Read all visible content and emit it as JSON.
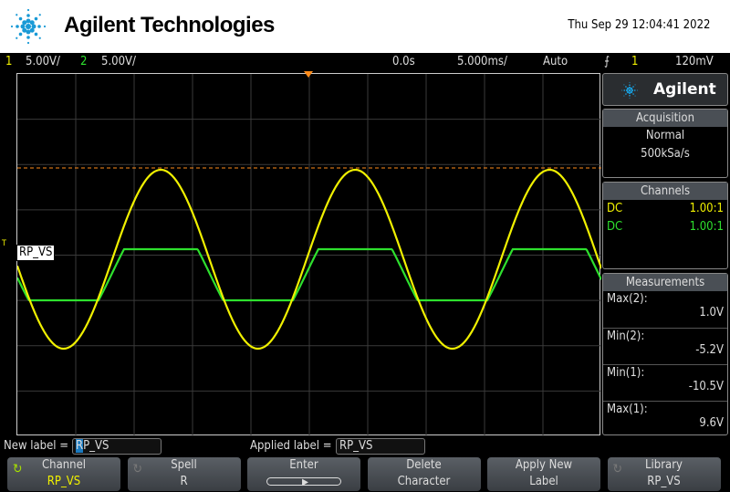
{
  "header": {
    "brand": "Agilent Technologies",
    "datetime": "Thu Sep 29 12:04:41 2022"
  },
  "status": {
    "ch1_num": "1",
    "ch1_scale": "5.00V/",
    "ch2_num": "2",
    "ch2_scale": "5.00V/",
    "delay": "0.0s",
    "timebase": "5.000ms/",
    "trigger_mode": "Auto",
    "trigger_slope_icon": "rising-edge-icon",
    "trigger_source": "1",
    "trigger_level": "120mV"
  },
  "screen": {
    "ground_marker": "T",
    "channel_label": "RP_VS"
  },
  "panel": {
    "logo": "Agilent",
    "acquisition": {
      "title": "Acquisition",
      "mode": "Normal",
      "rate": "500kSa/s"
    },
    "channels": {
      "title": "Channels",
      "rows": [
        {
          "coupling": "DC",
          "probe": "1.00:1",
          "color": "#f0f000"
        },
        {
          "coupling": "DC",
          "probe": "1.00:1",
          "color": "#2ee02e"
        }
      ]
    },
    "measurements": {
      "title": "Measurements",
      "items": [
        {
          "name": "Max(2):",
          "value": "1.0V"
        },
        {
          "name": "Min(2):",
          "value": "-5.2V"
        },
        {
          "name": "Min(1):",
          "value": "-10.5V"
        },
        {
          "name": "Max(1):",
          "value": "9.6V"
        }
      ]
    }
  },
  "label_bar": {
    "new_label": "New label =",
    "new_value": "RP_VS",
    "applied_label": "Applied label =",
    "applied_value": "RP_VS"
  },
  "softkeys": [
    {
      "title": "Channel",
      "value": "RP_VS"
    },
    {
      "title": "Spell",
      "value": "R"
    },
    {
      "title": "Enter",
      "value": ""
    },
    {
      "title": "Delete",
      "value": "Character"
    },
    {
      "title": "Apply New",
      "value": "Label"
    },
    {
      "title": "Library",
      "value": "RP_VS"
    }
  ],
  "colors": {
    "ch1": "#f0f000",
    "ch2": "#2ee02e",
    "trigger": "#ff8c1a"
  }
}
